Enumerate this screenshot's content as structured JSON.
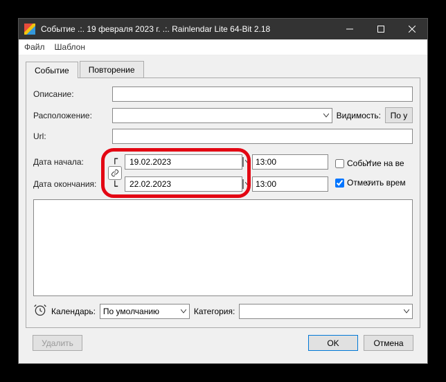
{
  "titlebar": {
    "text": "Событие .:. 19 февраля 2023 г. .:. Rainlendar Lite 64-Bit 2.18"
  },
  "menu": {
    "file": "Файл",
    "template": "Шаблон"
  },
  "tabs": {
    "event": "Событие",
    "repeat": "Повторение"
  },
  "labels": {
    "description": "Описание:",
    "location": "Расположение:",
    "visibility": "Видимость:",
    "visibility_value": "По у",
    "url": "Url:",
    "start_date": "Дата начала:",
    "end_date": "Дата окончания:",
    "allday": "Событие на ве",
    "mark_time": "Отметить врем",
    "calendar": "Календарь:",
    "calendar_value": "По умолчанию",
    "category": "Категория:"
  },
  "dates": {
    "start": "19.02.2023",
    "end": "22.02.2023",
    "start_time": "13:00",
    "end_time": "13:00"
  },
  "buttons": {
    "delete": "Удалить",
    "ok": "OK",
    "cancel": "Отмена"
  }
}
